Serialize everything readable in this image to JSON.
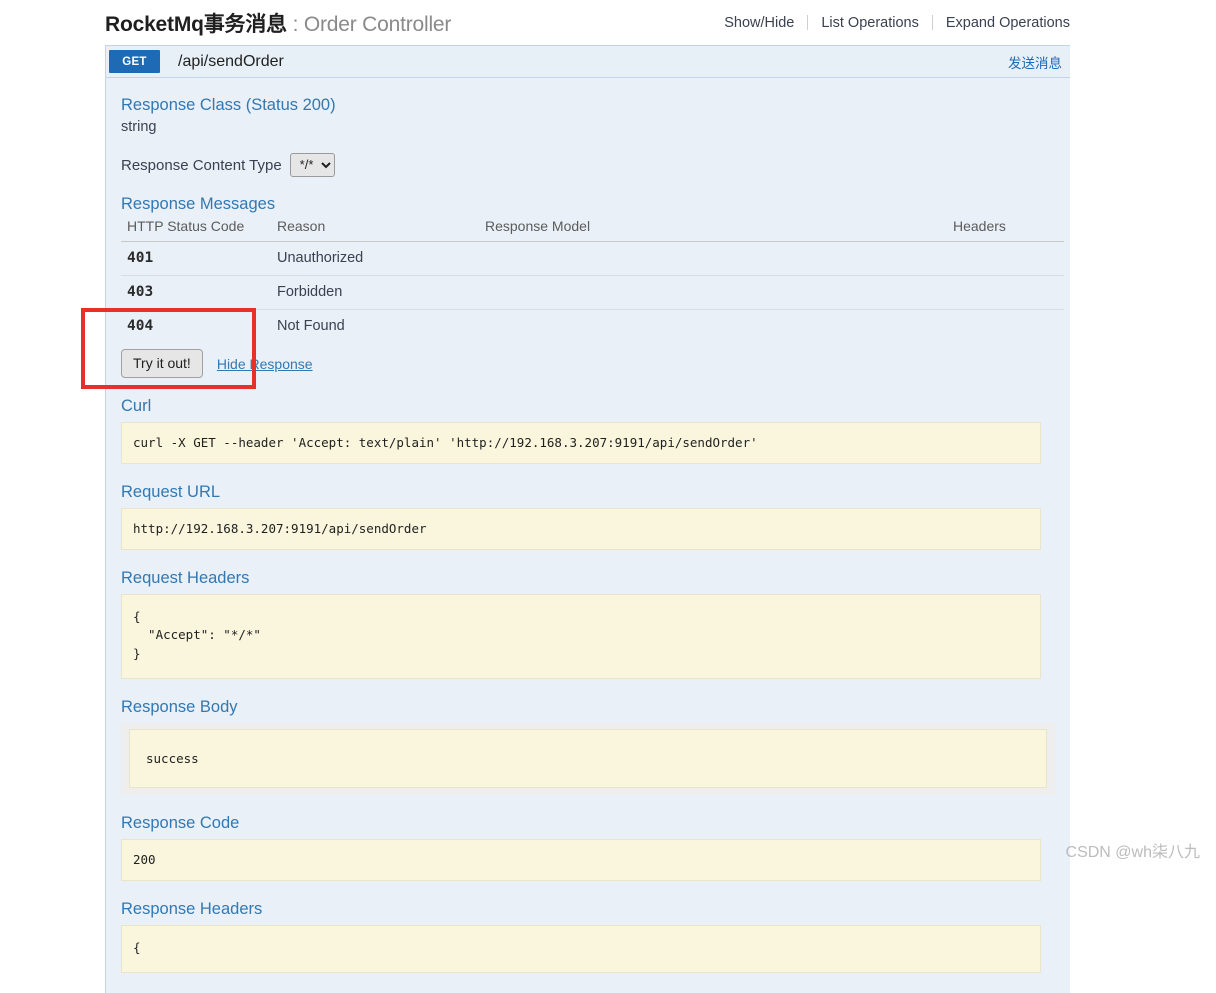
{
  "header": {
    "title_main": "RocketMq事务消息",
    "title_separator": " : ",
    "title_sub": "Order Controller",
    "links": [
      {
        "label": "Show/Hide"
      },
      {
        "label": "List Operations"
      },
      {
        "label": "Expand Operations"
      }
    ]
  },
  "operation": {
    "method": "GET",
    "path": "/api/sendOrder",
    "summary": "发送消息",
    "response_class_title": "Response Class (Status 200)",
    "response_class_type": "string",
    "content_type_label": "Response Content Type",
    "content_type_value": "*/*",
    "content_type_options": [
      "*/*"
    ],
    "response_messages_title": "Response Messages",
    "table": {
      "columns": [
        "HTTP Status Code",
        "Reason",
        "Response Model",
        "Headers"
      ],
      "rows": [
        {
          "code": "401",
          "reason": "Unauthorized",
          "model": "",
          "headers": ""
        },
        {
          "code": "403",
          "reason": "Forbidden",
          "model": "",
          "headers": ""
        },
        {
          "code": "404",
          "reason": "Not Found",
          "model": "",
          "headers": ""
        }
      ]
    },
    "try_it_out_label": "Try it out!",
    "hide_response_label": "Hide Response",
    "curl_title": "Curl",
    "curl_value": "curl -X GET --header 'Accept: text/plain' 'http://192.168.3.207:9191/api/sendOrder'",
    "request_url_title": "Request URL",
    "request_url_value": "http://192.168.3.207:9191/api/sendOrder",
    "request_headers_title": "Request Headers",
    "request_headers_value": "{\n  \"Accept\": \"*/*\"\n}",
    "response_body_title": "Response Body",
    "response_body_value": "success",
    "response_code_title": "Response Code",
    "response_code_value": "200",
    "response_headers_title": "Response Headers",
    "response_headers_value": "{"
  },
  "watermark": {
    "text": "CSDN @wh柒八九"
  },
  "colors": {
    "method_get": "#1f6ab5",
    "panel_bg": "#e9f0f7",
    "code_bg": "#faf6dd",
    "link": "#3278b3",
    "annotation": "#e8302a"
  }
}
